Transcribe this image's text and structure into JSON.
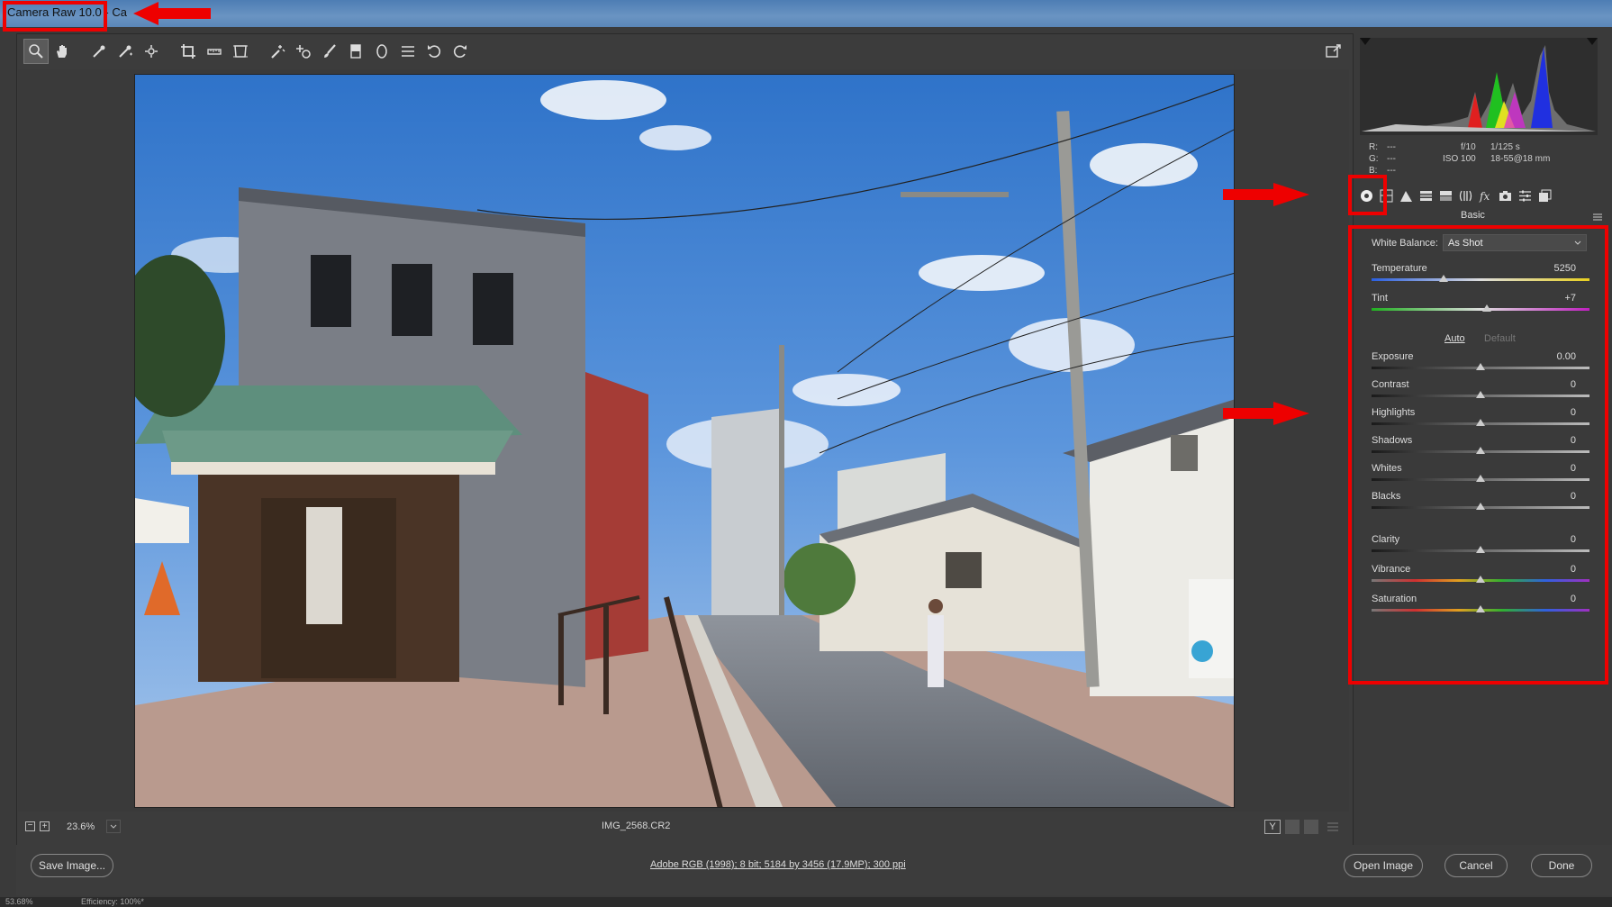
{
  "window": {
    "title": "Camera Raw 10.0",
    "title_suffix": "-  Ca"
  },
  "toolbar": {
    "tools": [
      "zoom-icon",
      "hand-icon",
      "white-balance-icon",
      "color-sampler-icon",
      "targeted-adjustment-icon",
      "crop-icon",
      "straighten-icon",
      "transform-icon",
      "spot-removal-icon",
      "redeye-icon",
      "adjustment-brush-icon",
      "graduated-filter-icon",
      "radial-filter-icon",
      "presets-list-icon",
      "rotate-ccw-icon",
      "rotate-cw-icon"
    ]
  },
  "status": {
    "zoom": "23.6%",
    "filename": "IMG_2568.CR2"
  },
  "camera_info": {
    "r_label": "R:",
    "r_value": "---",
    "g_label": "G:",
    "g_value": "---",
    "b_label": "B:",
    "b_value": "---",
    "aperture": "f/10",
    "shutter": "1/125 s",
    "iso": "ISO 100",
    "lens": "18-55@18 mm"
  },
  "panel": {
    "name": "Basic",
    "white_balance_label": "White Balance:",
    "white_balance_value": "As Shot",
    "auto_label": "Auto",
    "default_label": "Default",
    "sliders": [
      {
        "label": "Temperature",
        "value": "5250",
        "position": 0.33
      },
      {
        "label": "Tint",
        "value": "+7",
        "position": 0.53
      },
      {
        "label": "Exposure",
        "value": "0.00",
        "position": 0.5
      },
      {
        "label": "Contrast",
        "value": "0",
        "position": 0.5
      },
      {
        "label": "Highlights",
        "value": "0",
        "position": 0.5
      },
      {
        "label": "Shadows",
        "value": "0",
        "position": 0.5
      },
      {
        "label": "Whites",
        "value": "0",
        "position": 0.5
      },
      {
        "label": "Blacks",
        "value": "0",
        "position": 0.5
      },
      {
        "label": "Clarity",
        "value": "0",
        "position": 0.5
      },
      {
        "label": "Vibrance",
        "value": "0",
        "position": 0.5
      },
      {
        "label": "Saturation",
        "value": "0",
        "position": 0.5
      }
    ]
  },
  "bottom": {
    "save_label": "Save Image...",
    "info": "Adobe RGB (1998); 8 bit; 5184 by 3456 (17.9MP); 300 ppi",
    "open_label": "Open Image",
    "cancel_label": "Cancel",
    "done_label": "Done"
  },
  "taskbar": {
    "left_text": "53.68%",
    "efficiency": "Efficiency: 100%*"
  },
  "colors": {
    "annotation_red": "#e00000",
    "panel_bg": "#3a3a3a"
  }
}
